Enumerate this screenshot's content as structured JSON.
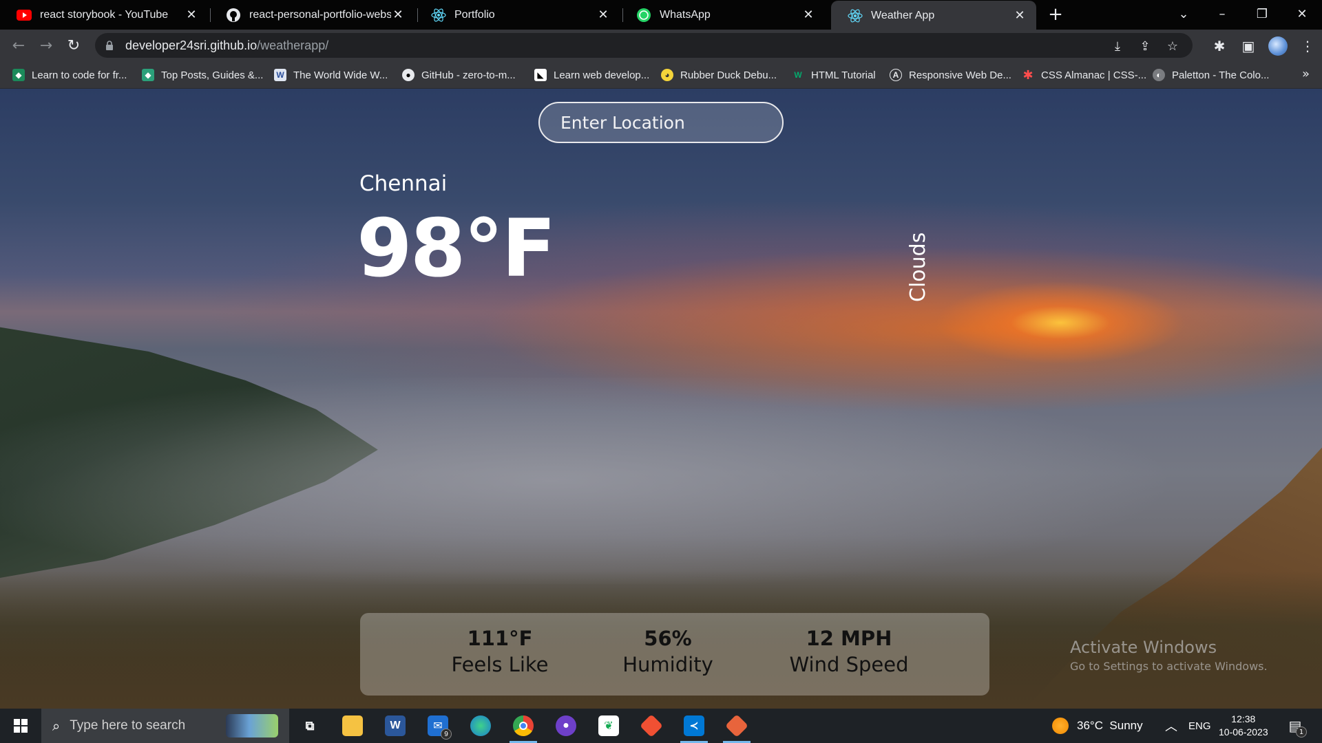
{
  "browser": {
    "tabs": [
      {
        "title": "react storybook - YouTube",
        "icon": "youtube-icon"
      },
      {
        "title": "react-personal-portfolio-website",
        "icon": "github-icon"
      },
      {
        "title": "Portfolio",
        "icon": "react-icon"
      },
      {
        "title": "WhatsApp",
        "icon": "whatsapp-icon"
      },
      {
        "title": "Weather App",
        "icon": "react-icon",
        "active": true
      }
    ],
    "url_host": "developer24sri.github.io",
    "url_path": "/weatherapp/",
    "bookmarks": [
      {
        "label": "Learn to code for fr...",
        "icon": "freecodecamp-icon"
      },
      {
        "label": "Top Posts, Guides &...",
        "icon": "devto-icon"
      },
      {
        "label": "The World Wide W...",
        "icon": "www-icon"
      },
      {
        "label": "GitHub - zero-to-m...",
        "icon": "github-icon"
      },
      {
        "label": "Learn web develop...",
        "icon": "mdn-icon"
      },
      {
        "label": "Rubber Duck Debu...",
        "icon": "duck-icon"
      },
      {
        "label": "HTML Tutorial",
        "icon": "w3schools-icon"
      },
      {
        "label": "Responsive Web De...",
        "icon": "a11y-icon"
      },
      {
        "label": "CSS Almanac | CSS-...",
        "icon": "css-tricks-icon"
      },
      {
        "label": "Paletton - The Colo...",
        "icon": "paletton-icon"
      }
    ]
  },
  "weather": {
    "search_placeholder": "Enter Location",
    "city": "Chennai",
    "temperature": "98°F",
    "description": "Clouds",
    "feels_like_value": "111°F",
    "feels_like_label": "Feels Like",
    "humidity_value": "56%",
    "humidity_label": "Humidity",
    "wind_value": "12 MPH",
    "wind_label": "Wind Speed"
  },
  "watermark": {
    "line1": "Activate Windows",
    "line2": "Go to Settings to activate Windows."
  },
  "taskbar": {
    "search_placeholder": "Type here to search",
    "mail_badge": "9",
    "weather": "36°C  Sunny",
    "language": "ENG",
    "time": "12:38",
    "date": "10-06-2023",
    "notification_count": "1"
  },
  "colors": {
    "tab_active": "#35363a",
    "tabbar": "#050505",
    "taskbar": "#1e2226",
    "taskbar_active_indicator": "#76b9ed"
  }
}
